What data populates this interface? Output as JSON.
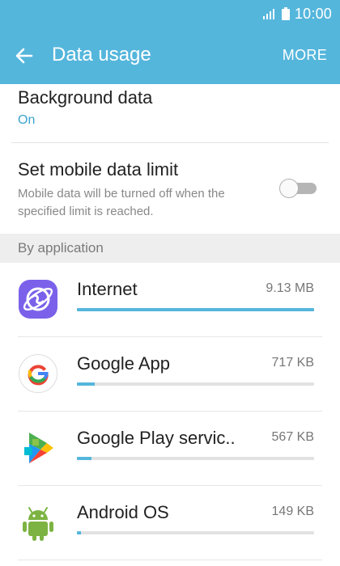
{
  "status_bar": {
    "time": "10:00",
    "icons": [
      "signal-icon",
      "battery-icon"
    ]
  },
  "app_bar": {
    "title": "Data usage",
    "back_icon": "arrow-left-icon",
    "more_label": "MORE"
  },
  "settings": {
    "background_data": {
      "title": "Background data",
      "value": "On"
    },
    "mobile_data_limit": {
      "title": "Set mobile data limit",
      "description": "Mobile data will be turned off when the specified limit is reached.",
      "enabled": false
    }
  },
  "section": {
    "label": "By application"
  },
  "apps": [
    {
      "name": "Internet",
      "size": "9.13 MB",
      "icon": "samsung-internet-icon",
      "usage_fraction": 1.0
    },
    {
      "name": "Google App",
      "size": "717 KB",
      "icon": "google-app-icon",
      "usage_fraction": 0.075
    },
    {
      "name": "Google Play servic..",
      "size": "567 KB",
      "icon": "google-play-services-icon",
      "usage_fraction": 0.062
    },
    {
      "name": "Android OS",
      "size": "149 KB",
      "icon": "android-os-icon",
      "usage_fraction": 0.016
    }
  ],
  "colors": {
    "accent": "#55b6dc",
    "value_text": "#3ca3cf",
    "usage_track": "#e2e2e2",
    "section_bg": "#eeeeee"
  }
}
